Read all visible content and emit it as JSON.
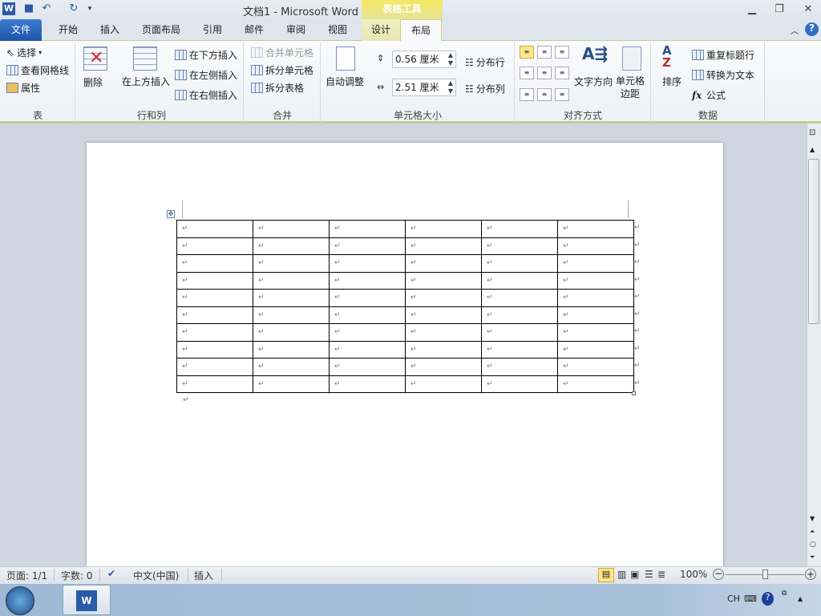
{
  "titlebar": {
    "title": "文档1  -  Microsoft Word",
    "tool_context": "表格工具"
  },
  "tabs": {
    "file": "文件",
    "home": "开始",
    "insert": "插入",
    "page_layout": "页面布局",
    "references": "引用",
    "mailings": "邮件",
    "review": "审阅",
    "view": "视图",
    "design": "设计",
    "layout": "布局"
  },
  "ribbon": {
    "table": {
      "select": "选择",
      "view_gridlines": "查看网格线",
      "properties": "属性",
      "label": "表"
    },
    "rows_cols": {
      "delete": "删除",
      "insert_above": "在上方插入",
      "insert_below": "在下方插入",
      "insert_left": "在左侧插入",
      "insert_right": "在右侧插入",
      "label": "行和列"
    },
    "merge": {
      "merge_cells": "合并单元格",
      "split_cells": "拆分单元格",
      "split_table": "拆分表格",
      "label": "合并"
    },
    "cell_size": {
      "autofit": "自动调整",
      "height": "0.56 厘米",
      "width": "2.51 厘米",
      "distribute_rows": "分布行",
      "distribute_cols": "分布列",
      "label": "单元格大小"
    },
    "alignment": {
      "text_direction": "文字方向",
      "cell_margins_1": "单元格",
      "cell_margins_2": "边距",
      "label": "对齐方式"
    },
    "data": {
      "sort": "排序",
      "repeat_header": "重复标题行",
      "convert_text": "转换为文本",
      "formula": "公式",
      "label": "数据"
    }
  },
  "document": {
    "rows": 10,
    "cols": 6,
    "cell_mark": "↵"
  },
  "status": {
    "page": "页面: 1/1",
    "words": "字数: 0",
    "language": "中文(中国)",
    "mode": "插入",
    "zoom": "100%"
  },
  "taskbar": {
    "ime": "CH"
  }
}
